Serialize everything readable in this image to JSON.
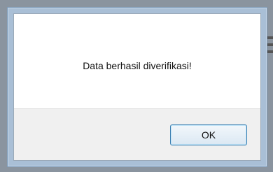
{
  "dialog": {
    "message": "Data berhasil diverifikasi!",
    "ok_label": "OK"
  },
  "colors": {
    "frame": "#a9bfd6",
    "button_border": "#3c7fb1",
    "background_accent": "#8ea12a"
  }
}
